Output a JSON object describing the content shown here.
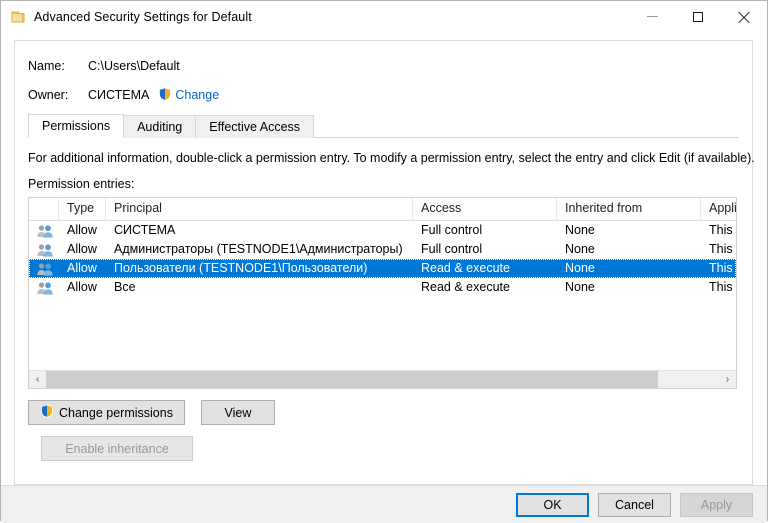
{
  "window": {
    "title": "Advanced Security Settings for Default",
    "icon": "folder-icon",
    "caption": {
      "minimize": "minimize-icon",
      "maximize": "maximize-icon",
      "close": "close-icon"
    }
  },
  "info": {
    "name_label": "Name:",
    "name_value": "C:\\Users\\Default",
    "owner_label": "Owner:",
    "owner_value": "СИСТЕМА",
    "change_link": "Change",
    "change_shield_icon": "uac-shield-icon"
  },
  "tabs": [
    {
      "label": "Permissions",
      "active": true
    },
    {
      "label": "Auditing",
      "active": false
    },
    {
      "label": "Effective Access",
      "active": false
    }
  ],
  "instructions": "For additional information, double-click a permission entry. To modify a permission entry, select the entry and click Edit (if available).",
  "entries_label": "Permission entries:",
  "table": {
    "columns": [
      "Type",
      "Principal",
      "Access",
      "Inherited from",
      "Applies to"
    ],
    "rows": [
      {
        "icon": "users-icon",
        "type": "Allow",
        "principal": "СИСТЕМА",
        "access": "Full control",
        "inherited_from": "None",
        "applies_to": "This folder",
        "selected": false
      },
      {
        "icon": "users-icon",
        "type": "Allow",
        "principal": "Администраторы (TESTNODE1\\Администраторы)",
        "access": "Full control",
        "inherited_from": "None",
        "applies_to": "This folder",
        "selected": false
      },
      {
        "icon": "users-icon",
        "type": "Allow",
        "principal": "Пользователи (TESTNODE1\\Пользователи)",
        "access": "Read & execute",
        "inherited_from": "None",
        "applies_to": "This folder",
        "selected": true
      },
      {
        "icon": "users-icon",
        "type": "Allow",
        "principal": "Все",
        "access": "Read & execute",
        "inherited_from": "None",
        "applies_to": "This folder",
        "selected": false
      }
    ]
  },
  "scrollbar": {
    "left_arrow": "‹",
    "right_arrow": "›",
    "thumb_percent": 91
  },
  "actions": {
    "change_permissions": "Change permissions",
    "change_permissions_shield": "uac-shield-icon",
    "view": "View",
    "enable_inheritance": "Enable inheritance",
    "enable_inheritance_disabled": true
  },
  "footer": {
    "ok": "OK",
    "cancel": "Cancel",
    "apply": "Apply",
    "apply_disabled": true
  },
  "colors": {
    "selection_blue": "#0078d7",
    "link_blue": "#0066cc",
    "shield_blue": "#1c6ec4",
    "shield_gold": "#f0b323",
    "folder_yellow": "#f4d06a",
    "window_bg": "#ffffff",
    "footer_bg": "#f0f0f0"
  }
}
